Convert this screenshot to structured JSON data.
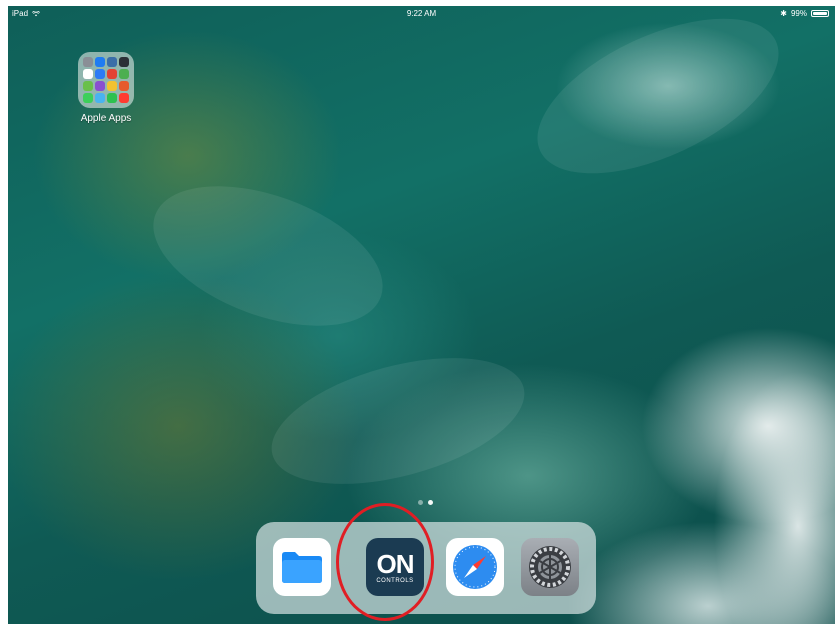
{
  "statusbar": {
    "device": "iPad",
    "time": "9:22 AM",
    "battery": "99%"
  },
  "home": {
    "folder_label": "Apple Apps",
    "folder_app_colors": [
      "#8a8f96",
      "#1f7cf2",
      "#3b6ea8",
      "#2b2f36",
      "#ffffff",
      "#2d7bf6",
      "#e34234",
      "#4caf50",
      "#6ac04a",
      "#8a4fd0",
      "#f3c230",
      "#e65b2d",
      "#3ccf5a",
      "#49b3f0",
      "#2fc14f",
      "#ff3b30"
    ],
    "page_dots": [
      "inactive",
      "active"
    ]
  },
  "dock": {
    "apps": [
      {
        "name": "Files"
      },
      {
        "name": "ON Controls",
        "logo_text": "ON",
        "logo_sub": "CONTROLS"
      },
      {
        "name": "Safari"
      },
      {
        "name": "Settings"
      }
    ]
  },
  "annotation": {
    "highlight_color": "#e01e24"
  }
}
